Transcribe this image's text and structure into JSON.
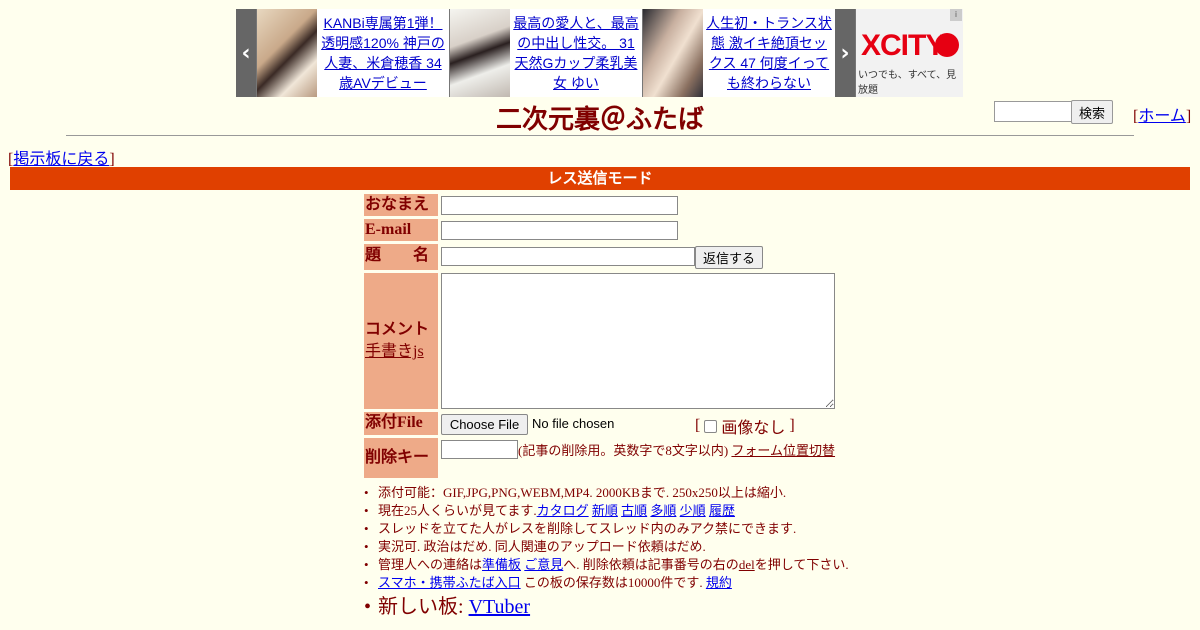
{
  "ad": {
    "items": [
      {
        "text": "KANBi専属第1弾！透明感120% 神戸の人妻、米倉穂香 34歳AVデビュー"
      },
      {
        "text": "最高の愛人と、最高の中出し性交。 31 天然Gカップ柔乳美女 ゆい"
      },
      {
        "text": "人生初・トランス状態 激イキ絶頂セックス 47 何度イっても終わらない"
      }
    ],
    "logo_text": "XCITY",
    "logo_tagline": "いつでも、すべて、見放題",
    "prev_arrow": "‹",
    "next_arrow": "›"
  },
  "header": {
    "title": "二次元裏＠ふたば",
    "search_button": "検索",
    "home_prefix": "[",
    "home_link": "ホーム",
    "home_suffix": "]",
    "back_prefix": "[",
    "back_link": "掲示板に戻る",
    "back_suffix": "]"
  },
  "mode_bar": "レス送信モード",
  "form": {
    "name_label": "おなまえ",
    "email_label": "E-mail",
    "subject_label": "題　　名",
    "submit_button": "返信する",
    "comment_label": "コメント",
    "handwriting_link": "手書きjs",
    "file_label": "添付File",
    "choose_file_button": "Choose File",
    "no_file_text": "No file chosen",
    "no_image_open": "[",
    "no_image_label": "画像なし",
    "no_image_close": "]",
    "delkey_label": "削除キー",
    "delkey_note": "(記事の削除用。英数字で8文字以内)",
    "form_toggle_link": "フォーム位置切替"
  },
  "notes": {
    "line1": "添付可能：GIF,JPG,PNG,WEBM,MP4. 2000KBまで. 250x250以上は縮小.",
    "line2_prefix": "現在25人くらいが見てます.",
    "line2_links": [
      "カタログ",
      "新順",
      "古順",
      "多順",
      "少順",
      "履歴"
    ],
    "line3": "スレッドを立てた人がレスを削除してスレッド内のみアク禁にできます.",
    "line4": "実況可. 政治はだめ. 同人関連のアップロード依頼はだめ.",
    "line5_prefix": "管理人への連絡は",
    "line5_link1": "準備板",
    "line5_link2": "ご意見",
    "line5_mid": "へ. 削除依頼は記事番号の右の",
    "line5_del": "del",
    "line5_suffix": "を押して下さい.",
    "line6_link": "スマホ・携帯ふたば入口",
    "line6_mid": " この板の保存数は10000件です.",
    "line6_rules": "規約",
    "line7_prefix": "新しい板: ",
    "line7_link": "VTuber"
  }
}
